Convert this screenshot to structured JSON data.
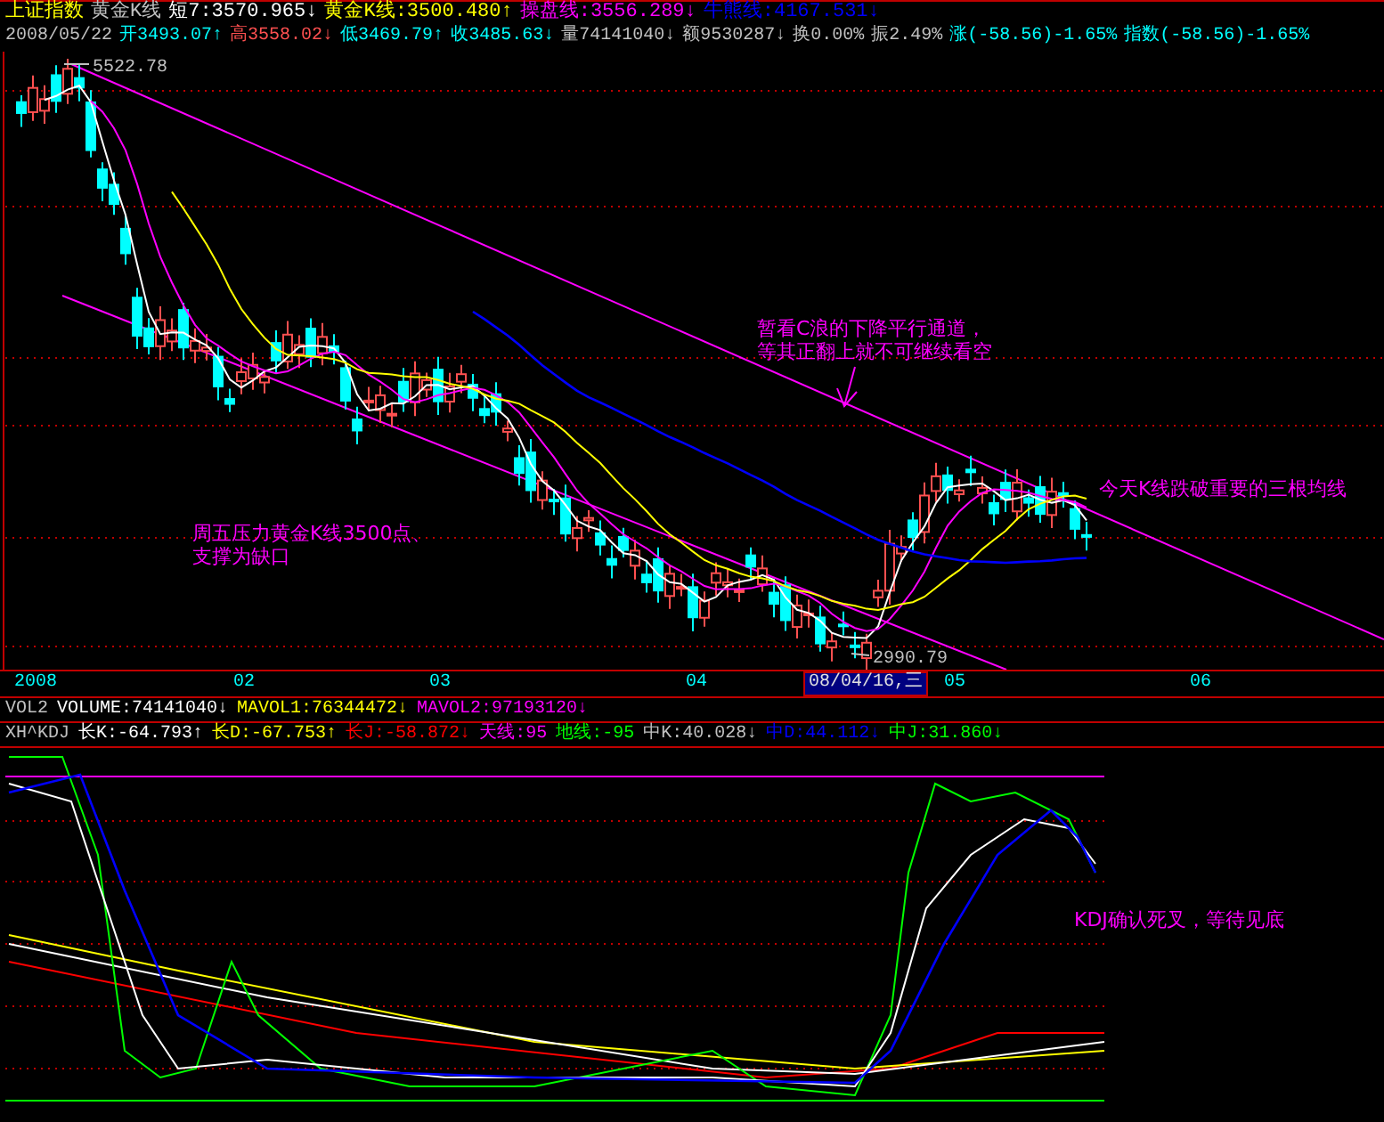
{
  "header": {
    "row1": [
      {
        "text": "上证指数",
        "color": "#ffff00"
      },
      {
        "text": "黄金K线",
        "color": "#c0c0c0"
      },
      {
        "text": "短7:3570.965↓",
        "color": "#ffffff"
      },
      {
        "text": "黄金K线:3500.480↑",
        "color": "#ffff00"
      },
      {
        "text": "操盘线:3556.289↓",
        "color": "#ff00ff"
      },
      {
        "text": "牛熊线:4167.531↓",
        "color": "#0000ff"
      }
    ],
    "row2": [
      {
        "text": "2008/05/22",
        "color": "#c0c0c0"
      },
      {
        "text": "开3493.07↑",
        "color": "#00ffff"
      },
      {
        "text": "高3558.02↓",
        "color": "#ff5050"
      },
      {
        "text": "低3469.79↑",
        "color": "#00ffff"
      },
      {
        "text": "收3485.63↓",
        "color": "#00ffff"
      },
      {
        "text": "量74141040↓",
        "color": "#c0c0c0"
      },
      {
        "text": "额9530287↓",
        "color": "#c0c0c0"
      },
      {
        "text": "换0.00%",
        "color": "#c0c0c0"
      },
      {
        "text": "振2.49%",
        "color": "#c0c0c0"
      },
      {
        "text": "涨(-58.56)-1.65%",
        "color": "#00ffff"
      },
      {
        "text": "指数(-58.56)-1.65%",
        "color": "#00ffff"
      }
    ]
  },
  "price_chart": {
    "high_label": "5522.78",
    "low_label": "2990.79",
    "annotations": [
      {
        "lines": [
          "暂看C浪的下降平行通道，",
          "等其正翻上就不可继续看空"
        ]
      },
      {
        "lines": [
          "今天K线跌破重要的三根均线"
        ]
      },
      {
        "lines": [
          "周五压力黄金K线3500点、",
          "支撑为缺口"
        ]
      }
    ]
  },
  "date_axis": {
    "labels": [
      "2008",
      "02",
      "03",
      "04",
      "05",
      "06"
    ],
    "cursor_date": "08/04/16,三"
  },
  "volume_legend": [
    {
      "text": "VOL2"
    },
    {
      "text": "VOLUME:74141040↓"
    },
    {
      "text": "MAVOL1:76344472↓"
    },
    {
      "text": "MAVOL2:97193120↓"
    }
  ],
  "kdj_legend": [
    {
      "text": "XH^KDJ"
    },
    {
      "text": "长K:-64.793↑"
    },
    {
      "text": "长D:-67.753↑"
    },
    {
      "text": "长J:-58.872↓"
    },
    {
      "text": "天线:95"
    },
    {
      "text": "地线:-95"
    },
    {
      "text": "中K:40.028↓"
    },
    {
      "text": "中D:44.112↓"
    },
    {
      "text": "中J:31.860↓"
    }
  ],
  "kdj_chart": {
    "annotation": "KDJ确认死叉，等待见底"
  }
}
